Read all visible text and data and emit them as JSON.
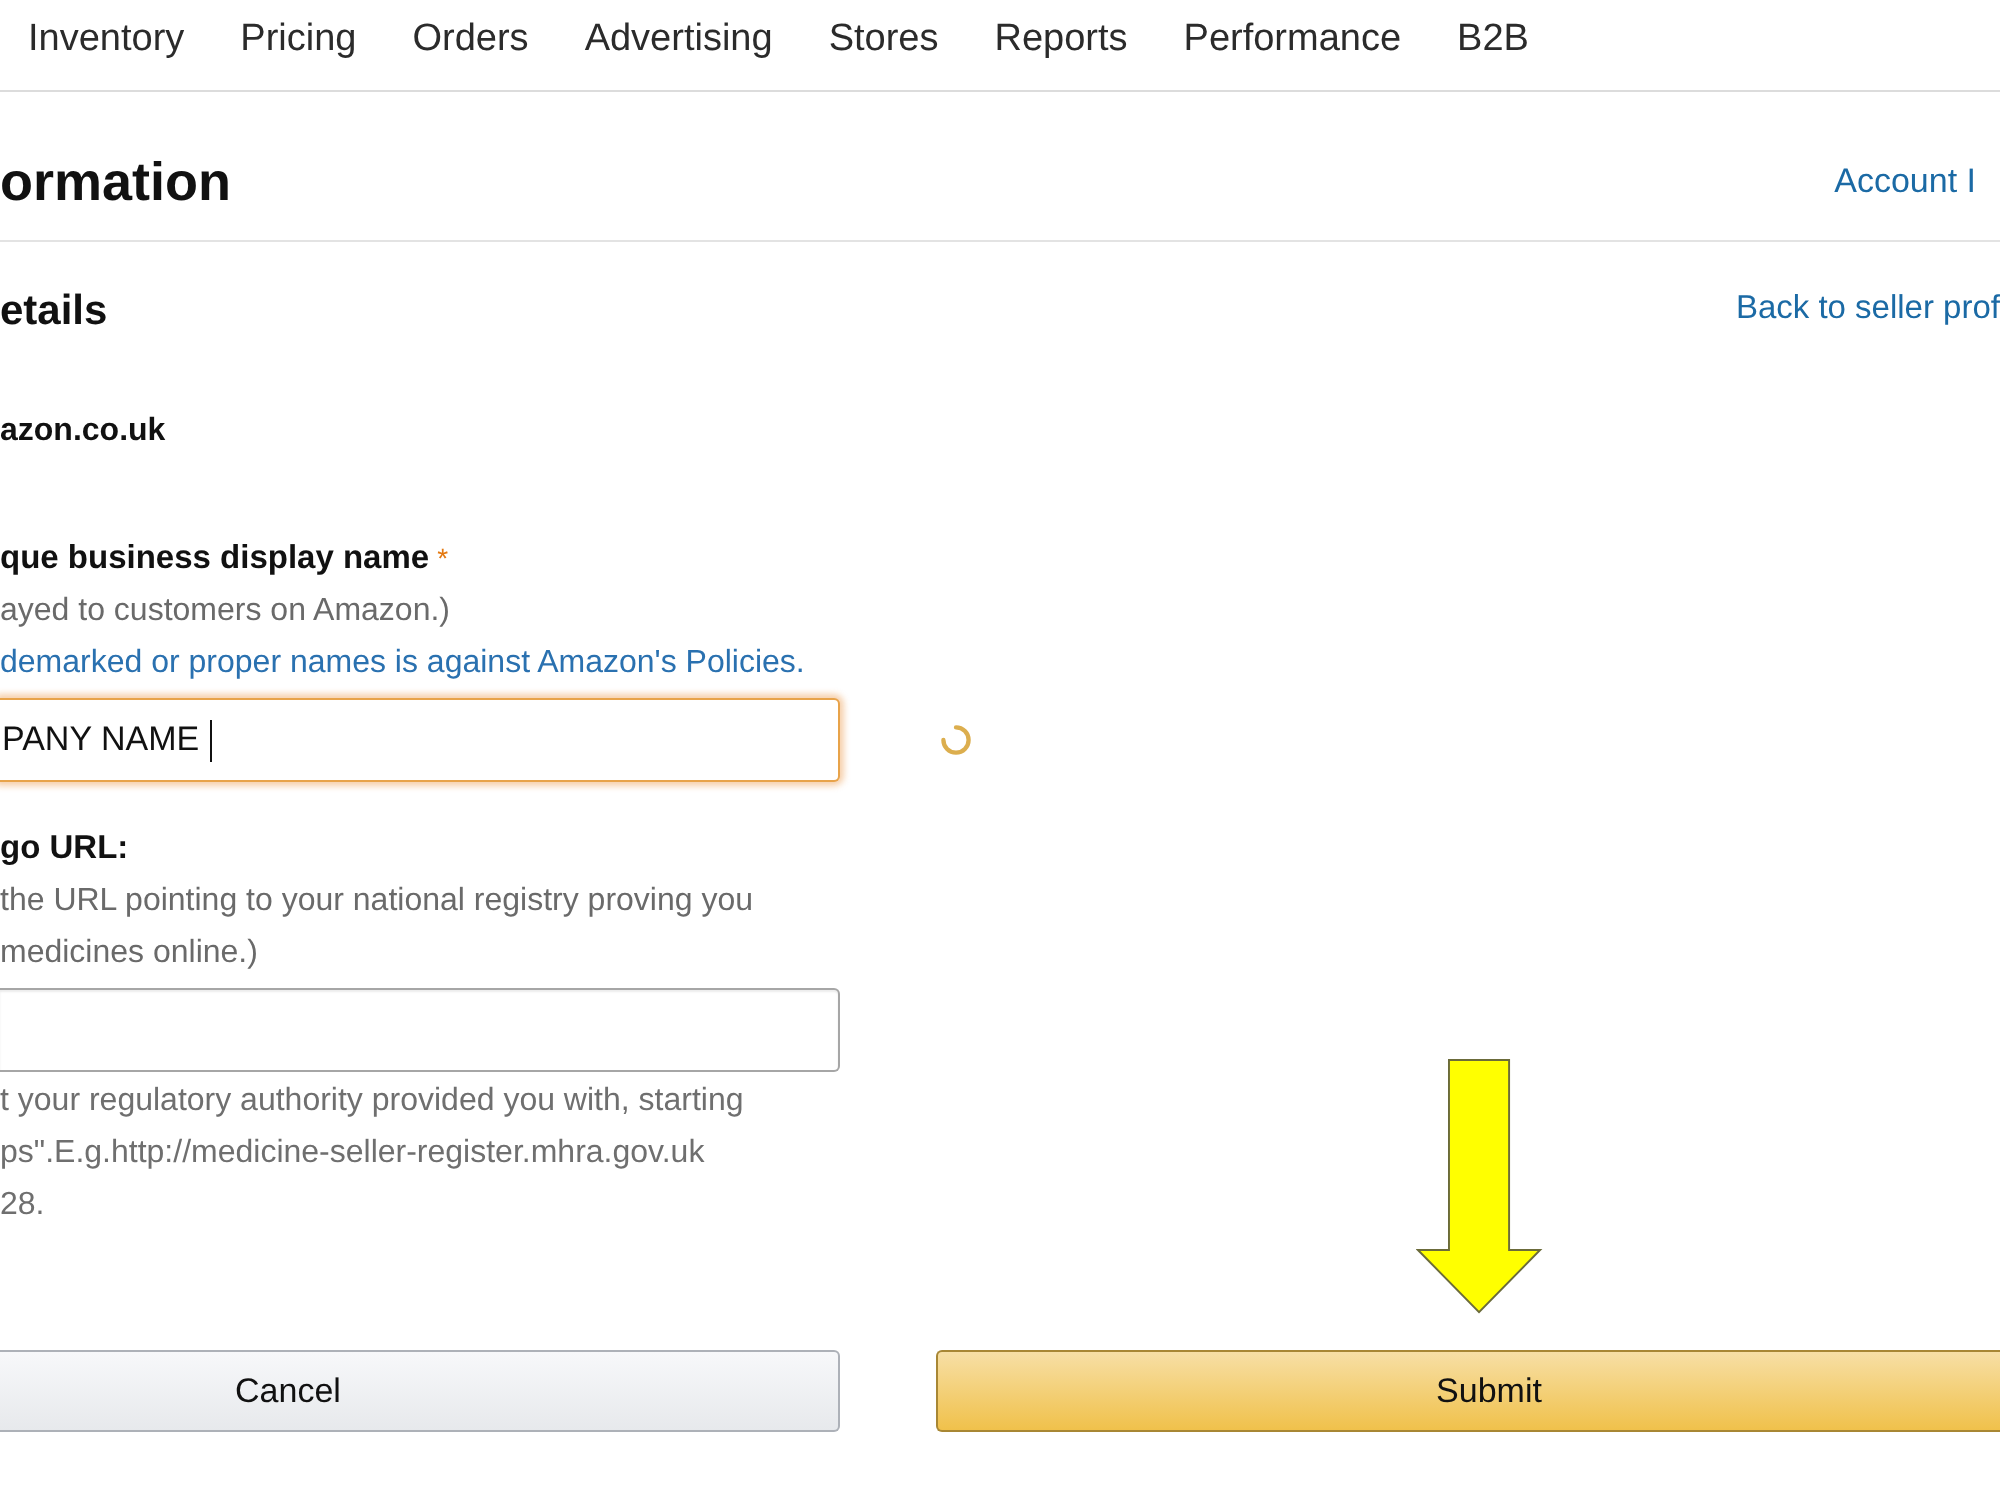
{
  "nav": {
    "items": [
      "Inventory",
      "Pricing",
      "Orders",
      "Advertising",
      "Stores",
      "Reports",
      "Performance",
      "B2B"
    ]
  },
  "page_header": {
    "title": "ormation",
    "link": "Account I"
  },
  "section": {
    "title": "etails",
    "link": "Back to seller prof"
  },
  "marketplace": "azon.co.uk",
  "fields": [
    {
      "label": "que business display name",
      "required_mark": "*",
      "hints": [
        "ayed to customers on Amazon.)"
      ],
      "notice": "demarked or proper names is against Amazon's Policies.",
      "value": "PANY NAME",
      "focused": true,
      "loading": true
    },
    {
      "label": "go URL:",
      "hints": [
        "the URL pointing to your national registry proving you",
        "medicines online.)"
      ],
      "focused": false,
      "loading": false,
      "help": [
        "t your regulatory authority provided you with, starting",
        "ps\".E.g.http://medicine-seller-register.mhra.gov.uk",
        "28."
      ]
    }
  ],
  "annotations": [
    {
      "kind": "arrow"
    }
  ],
  "buttons": [
    {
      "label": "Cancel",
      "kind": "secondary"
    },
    {
      "label": "Submit",
      "kind": "primary"
    }
  ]
}
